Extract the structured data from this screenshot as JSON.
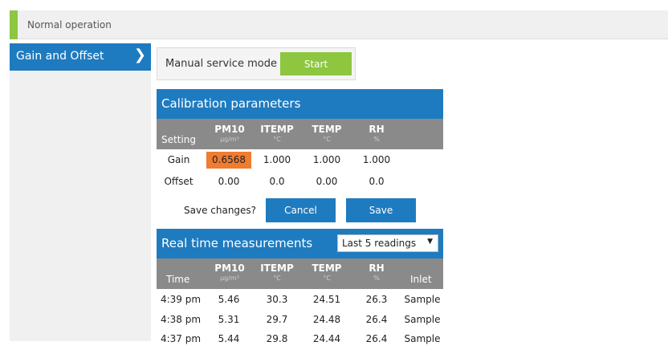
{
  "status": {
    "text": "Normal operation"
  },
  "sidebar": {
    "items": [
      {
        "label": "Gain and Offset",
        "chevron": "❯"
      }
    ]
  },
  "service": {
    "label": "Manual service mode",
    "start_label": "Start"
  },
  "calibration": {
    "title": "Calibration parameters",
    "first_col": "Setting",
    "columns": [
      {
        "name": "PM10",
        "unit": "µg/m³"
      },
      {
        "name": "ITEMP",
        "unit": "°C"
      },
      {
        "name": "TEMP",
        "unit": "°C"
      },
      {
        "name": "RH",
        "unit": "%"
      }
    ],
    "rows": [
      {
        "label": "Gain",
        "values": [
          "0.6568",
          "1.000",
          "1.000",
          "1.000"
        ]
      },
      {
        "label": "Offset",
        "values": [
          "0.00",
          "0.0",
          "0.00",
          "0.0"
        ]
      }
    ],
    "save_question": "Save changes?",
    "cancel_label": "Cancel",
    "save_label": "Save"
  },
  "realtime": {
    "title": "Real time measurements",
    "select_value": "Last 5 readings",
    "first_col": "Time",
    "columns": [
      {
        "name": "PM10",
        "unit": "µg/m³"
      },
      {
        "name": "ITEMP",
        "unit": "°C"
      },
      {
        "name": "TEMP",
        "unit": "°C"
      },
      {
        "name": "RH",
        "unit": "%"
      }
    ],
    "last_col": "Inlet",
    "rows": [
      {
        "time": "4:39 pm",
        "values": [
          "5.46",
          "30.3",
          "24.51",
          "26.3"
        ],
        "inlet": "Sample"
      },
      {
        "time": "4:38 pm",
        "values": [
          "5.31",
          "29.7",
          "24.48",
          "26.4"
        ],
        "inlet": "Sample"
      },
      {
        "time": "4:37 pm",
        "values": [
          "5.44",
          "29.8",
          "24.44",
          "26.4"
        ],
        "inlet": "Sample"
      }
    ]
  },
  "colors": {
    "accent": "#8dc63f",
    "primary": "#1f7bbf",
    "header_gray": "#8a8a8a",
    "highlight": "#f07c30"
  }
}
